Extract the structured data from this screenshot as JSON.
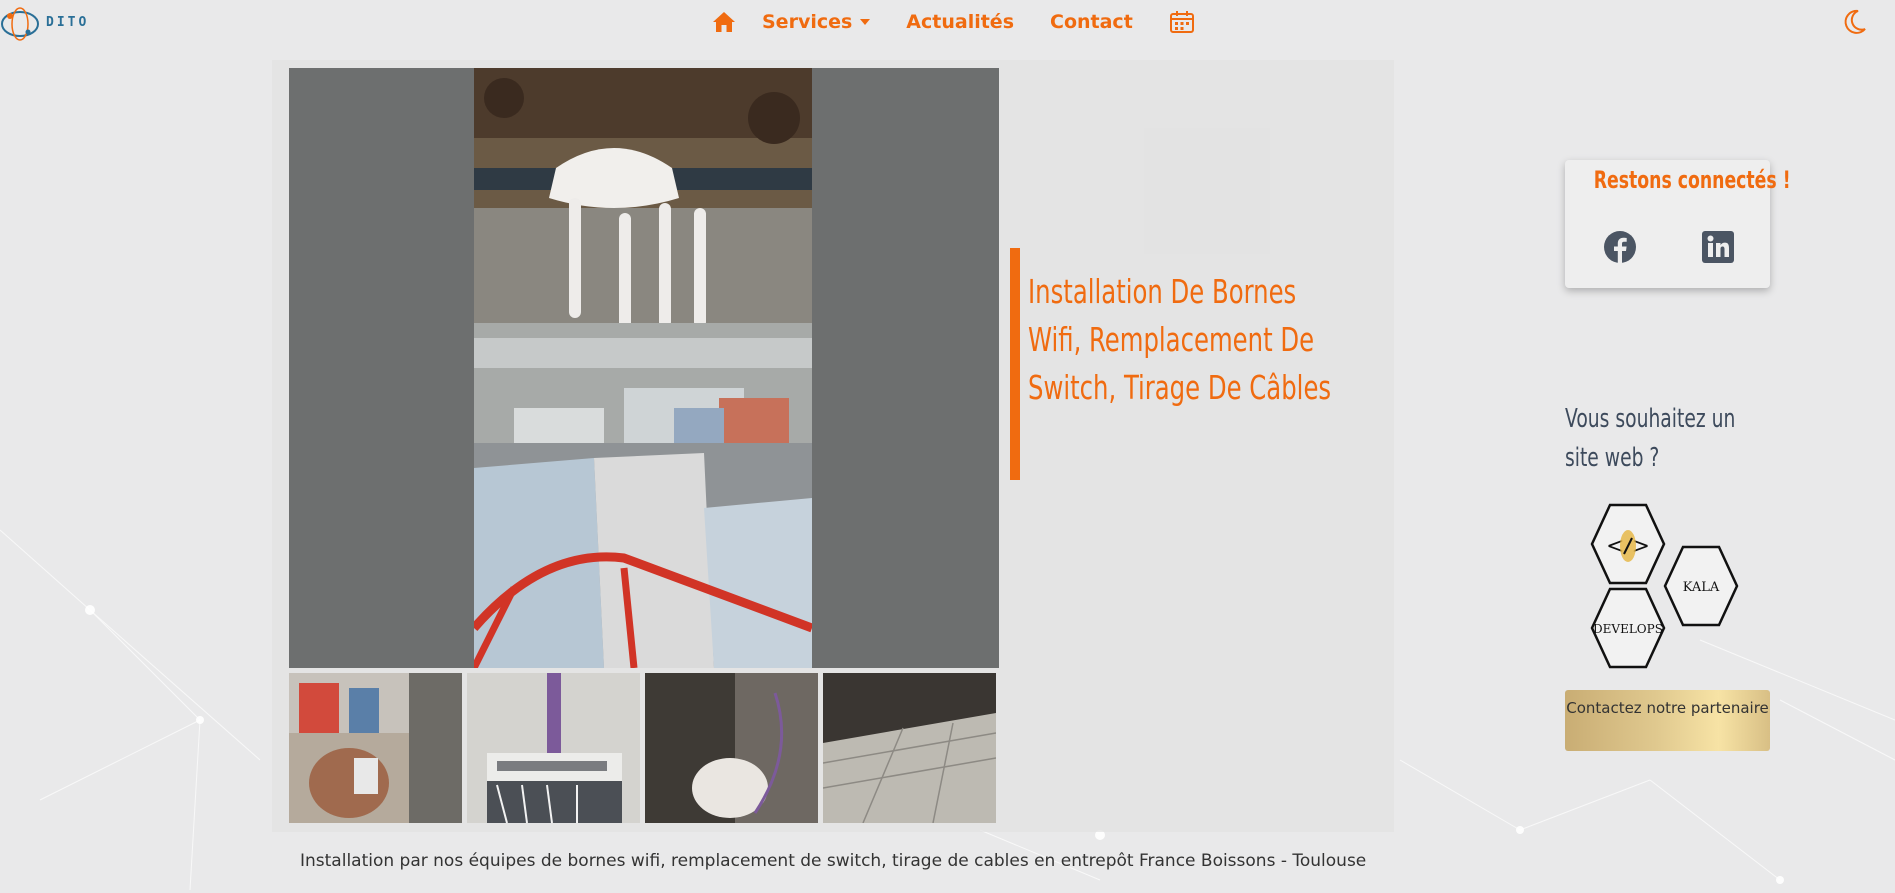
{
  "brand": {
    "logo_text": "DITO"
  },
  "nav": {
    "items": [
      {
        "label": "Services",
        "has_dropdown": true
      },
      {
        "label": "Actualités"
      },
      {
        "label": "Contact"
      }
    ]
  },
  "article": {
    "title": "Installation De Bornes Wifi, Remplacement De Switch, Tirage De Câbles",
    "caption": "Installation par nos équipes de bornes wifi, remplacement de switch, tirage de cables en entrepôt France Boissons - Toulouse"
  },
  "sidebar": {
    "social_title": "Restons connectés !",
    "site_question": "Vous souhaitez un site web ?",
    "partner_hex_labels": [
      "KALA",
      "DEVELOPS"
    ],
    "partner_button": "Contactez notre partenaire"
  },
  "colors": {
    "accent": "#f06b10",
    "text_dark": "#3d4a5c",
    "photo_bg": "#6d6f6f"
  }
}
